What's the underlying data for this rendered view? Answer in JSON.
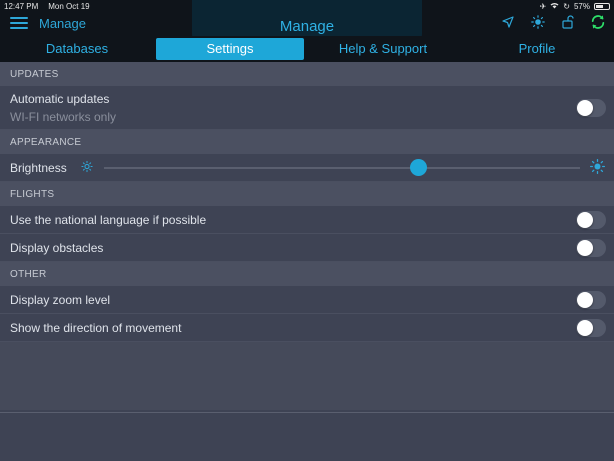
{
  "statusbar": {
    "time": "12:47 PM",
    "date": "Mon Oct 19",
    "battery": "57%",
    "battery_level": 0.57
  },
  "appbar": {
    "back_title": "Manage",
    "title": "Manage",
    "icons": [
      "location-arrow-icon",
      "sun-icon",
      "unlock-icon",
      "sync-icon"
    ]
  },
  "tabs": [
    {
      "label": "Databases"
    },
    {
      "label": "Settings",
      "active": true
    },
    {
      "label": "Help & Support"
    },
    {
      "label": "Profile"
    }
  ],
  "sections": {
    "updates": {
      "header": "UPDATES",
      "auto_updates": {
        "label": "Automatic updates",
        "sub": "WI-FI networks only",
        "on": false
      }
    },
    "appearance": {
      "header": "APPEARANCE",
      "brightness": {
        "label": "Brightness",
        "value": 0.66
      }
    },
    "flights": {
      "header": "FLIGHTS",
      "national_language": {
        "label": "Use the national language if possible",
        "on": false
      },
      "obstacles": {
        "label": "Display obstacles",
        "on": false
      }
    },
    "other": {
      "header": "OTHER",
      "zoom_level": {
        "label": "Display zoom level",
        "on": false
      },
      "direction": {
        "label": "Show the direction of movement",
        "on": false
      }
    }
  },
  "colors": {
    "accent": "#1ea7d8",
    "accent_text": "#2fb1e4",
    "bg": "#3e4354",
    "header_bg": "#4b5061",
    "bar": "#0f141a"
  }
}
